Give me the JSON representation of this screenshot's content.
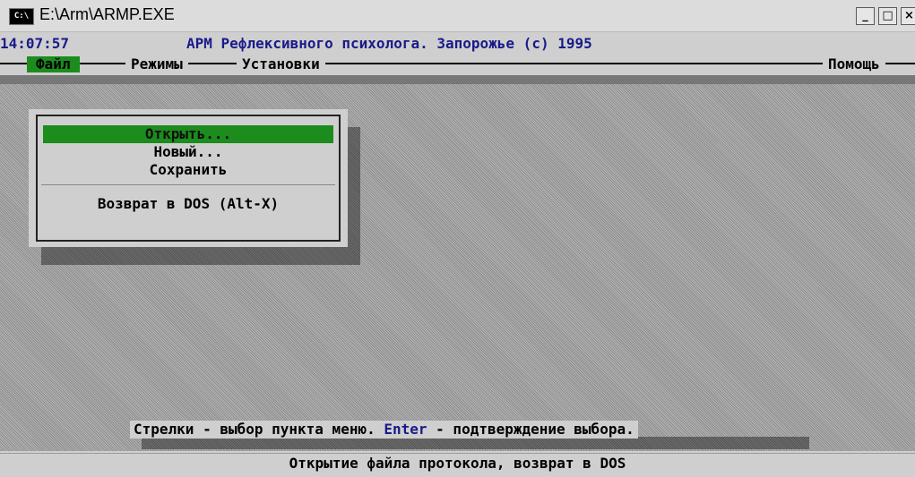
{
  "window": {
    "title": "E:\\Arm\\ARMP.EXE",
    "icon": "cmd-icon",
    "icon_text": "C:\\",
    "controls": {
      "minimize": "_",
      "maximize": "□",
      "close": "×"
    }
  },
  "header": {
    "clock": "14:07:57",
    "app_title": "АРМ Рефлексивного психолога. Запорожье (с) 1995"
  },
  "menubar": {
    "items": [
      {
        "label": "Файл",
        "active": true
      },
      {
        "label": "Режимы",
        "active": false
      },
      {
        "label": "Установки",
        "active": false
      },
      {
        "label": "Помощь",
        "active": false
      }
    ]
  },
  "file_menu": {
    "items": [
      {
        "label": "Открыть...",
        "selected": true
      },
      {
        "label": "Новый...",
        "selected": false
      },
      {
        "label": "Сохранить",
        "selected": false
      },
      {
        "label": "Возврат в DOS (Alt-X)",
        "selected": false
      }
    ]
  },
  "hint": {
    "part1": "Стрелки - выбор пункта меню. ",
    "key": "Enter",
    "part2": " - подтверждение выбора."
  },
  "status": {
    "text": "Открытие файла протокола, возврат в DOS"
  },
  "colors": {
    "menu_highlight": "#1c8c1c",
    "title_text": "#1a1a8a",
    "background": "#cfcfcf"
  }
}
